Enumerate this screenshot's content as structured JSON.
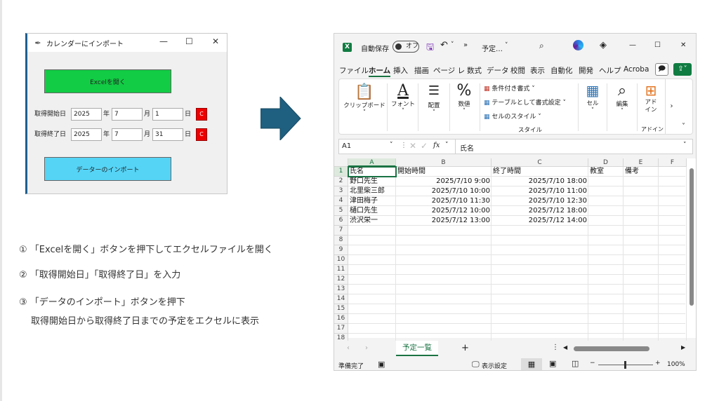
{
  "tk": {
    "title": "カレンダーにインポート",
    "minimize": "—",
    "maximize": "☐",
    "close": "✕",
    "open_excel": "Excelを開く",
    "start_label": "取得開始日",
    "end_label": "取得終了日",
    "start_year": "2025",
    "start_month": "7",
    "start_day": "1",
    "end_year": "2025",
    "end_month": "7",
    "end_day": "31",
    "year_unit": "年",
    "month_unit": "月",
    "day_unit": "日",
    "c_btn": "C",
    "import_button": "データーのインポート",
    "colors": {
      "green": "#11cc44",
      "cyan": "#55d4f6",
      "red": "#ee0000"
    }
  },
  "instructions": {
    "step1": "① 「Excelを開く」ボタンを押下してエクセルファイルを開く",
    "step2": "② 「取得開始日」「取得終了日」を入力",
    "step3": "③ 「データのインポート」ボタンを押下",
    "step3b": "取得開始日から取得終了日までの予定をエクセルに表示"
  },
  "excel": {
    "autosave_label": "自動保存",
    "autosave_state": "オフ",
    "overflow": "»",
    "filename": "予定…",
    "tabs": [
      "ファイル",
      "ホーム",
      "挿入",
      "描画",
      "ページ レ",
      "数式",
      "データ",
      "校閲",
      "表示",
      "自動化",
      "開発",
      "ヘルプ",
      "Acroba"
    ],
    "ribbon": {
      "clipboard": "クリップボード",
      "font": "フォント",
      "align": "配置",
      "number": "数値",
      "cond_format": "条件付き書式",
      "table_format": "テーブルとして書式設定",
      "cell_style": "セルのスタイル",
      "style_group": "スタイル",
      "cell": "セル",
      "edit": "編集",
      "addin": "アド イン",
      "addin_group": "アドイン"
    },
    "namebox": "A1",
    "formula": "氏名",
    "fx": "fx",
    "columns": [
      "A",
      "B",
      "C",
      "D",
      "E",
      "F"
    ],
    "rows": [
      [
        "氏名",
        "開始時間",
        "終了時間",
        "教室",
        "備考"
      ],
      [
        "野口先生",
        "2025/7/10 9:00",
        "2025/7/10 18:00",
        "",
        ""
      ],
      [
        "北里柴三郎",
        "2025/7/10 10:00",
        "2025/7/10 11:00",
        "",
        ""
      ],
      [
        "津田梅子",
        "2025/7/10 11:30",
        "2025/7/10 12:30",
        "",
        ""
      ],
      [
        "樋口先生",
        "2025/7/12 10:00",
        "2025/7/12 18:00",
        "",
        ""
      ],
      [
        "渋沢栄一",
        "2025/7/12 13:00",
        "2025/7/12 14:00",
        "",
        ""
      ]
    ],
    "row_numbers": [
      "1",
      "2",
      "3",
      "4",
      "5",
      "6",
      "7",
      "8",
      "9",
      "10",
      "11",
      "12",
      "13",
      "14",
      "15",
      "16",
      "17",
      "18"
    ],
    "sheet_name": "予定一覧",
    "add_sheet": "+",
    "status_ready": "準備完了",
    "display_settings": "表示設定",
    "zoom": "100%",
    "colors": {
      "excel_green": "#107c41",
      "accent": "#1a7343"
    }
  }
}
